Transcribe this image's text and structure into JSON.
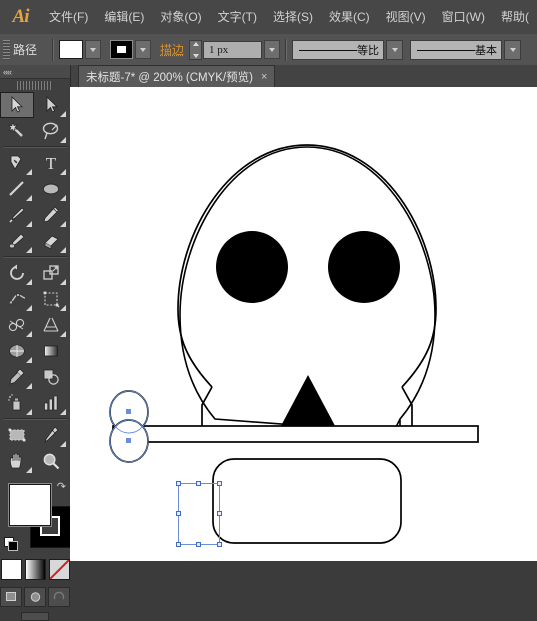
{
  "app": {
    "logo": "Ai",
    "menus": [
      "文件(F)",
      "编辑(E)",
      "对象(O)",
      "文字(T)",
      "选择(S)",
      "效果(C)",
      "视图(V)",
      "窗口(W)",
      "帮助("
    ]
  },
  "control_bar": {
    "object_type": "路径",
    "fill_swatch_name": "fill-swatch",
    "fill_color": "#ffffff",
    "stroke_swatch_name": "stroke-swatch",
    "stroke_color": "#000000",
    "stroke_link_label": "描边",
    "stroke_weight": "1  px",
    "profile_dropdown": "等比",
    "brush_dropdown": "基本"
  },
  "document_tab": {
    "title": "未标题-7* @ 200% (CMYK/预览)",
    "close_label": "×"
  },
  "tools_panel": {
    "collapse_label": "««",
    "items": [
      {
        "name": "selection-tool",
        "selected": true
      },
      {
        "name": "direct-selection-tool",
        "selected": false
      },
      {
        "name": "magic-wand-tool",
        "selected": false
      },
      {
        "name": "lasso-tool",
        "selected": false
      },
      {
        "name": "pen-tool",
        "selected": false
      },
      {
        "name": "type-tool",
        "selected": false
      },
      {
        "name": "line-segment-tool",
        "selected": false
      },
      {
        "name": "ellipse-tool",
        "selected": false
      },
      {
        "name": "paintbrush-tool",
        "selected": false
      },
      {
        "name": "pencil-tool",
        "selected": false
      },
      {
        "name": "blob-brush-tool",
        "selected": false
      },
      {
        "name": "eraser-tool",
        "selected": false
      },
      {
        "name": "rotate-tool",
        "selected": false
      },
      {
        "name": "scale-tool",
        "selected": false
      },
      {
        "name": "width-tool",
        "selected": false
      },
      {
        "name": "free-transform-tool",
        "selected": false
      },
      {
        "name": "shape-builder-tool",
        "selected": false
      },
      {
        "name": "perspective-grid-tool",
        "selected": false
      },
      {
        "name": "mesh-tool",
        "selected": false
      },
      {
        "name": "gradient-tool",
        "selected": false
      },
      {
        "name": "eyedropper-tool",
        "selected": false
      },
      {
        "name": "blend-tool",
        "selected": false
      },
      {
        "name": "symbol-sprayer-tool",
        "selected": false
      },
      {
        "name": "column-graph-tool",
        "selected": false
      },
      {
        "name": "artboard-tool",
        "selected": false
      },
      {
        "name": "slice-tool",
        "selected": false
      },
      {
        "name": "hand-tool",
        "selected": false
      },
      {
        "name": "zoom-tool",
        "selected": false
      }
    ],
    "fill_color": "#ffffff",
    "stroke_color": "#000000",
    "color_modes": [
      "color-button",
      "gradient-button",
      "none-button"
    ],
    "screen_modes": [
      "normal-screen-mode",
      "full-screen-menu-mode",
      "full-screen-mode"
    ]
  },
  "artwork": {
    "name": "skull-illustration",
    "shapes": [
      {
        "name": "skull-head",
        "stroke": "#000000",
        "fill": "#ffffff"
      },
      {
        "name": "left-eye",
        "fill": "#000000"
      },
      {
        "name": "right-eye",
        "fill": "#000000"
      },
      {
        "name": "nose-triangle",
        "fill": "#000000"
      },
      {
        "name": "horizontal-bar",
        "stroke": "#000000",
        "fill": "#ffffff"
      },
      {
        "name": "jaw-rounded-rect",
        "stroke": "#000000",
        "fill": "#ffffff"
      },
      {
        "name": "selected-circles",
        "stroke": "#000000",
        "fill": "none"
      }
    ],
    "selection_color": "#3f6bc4"
  }
}
